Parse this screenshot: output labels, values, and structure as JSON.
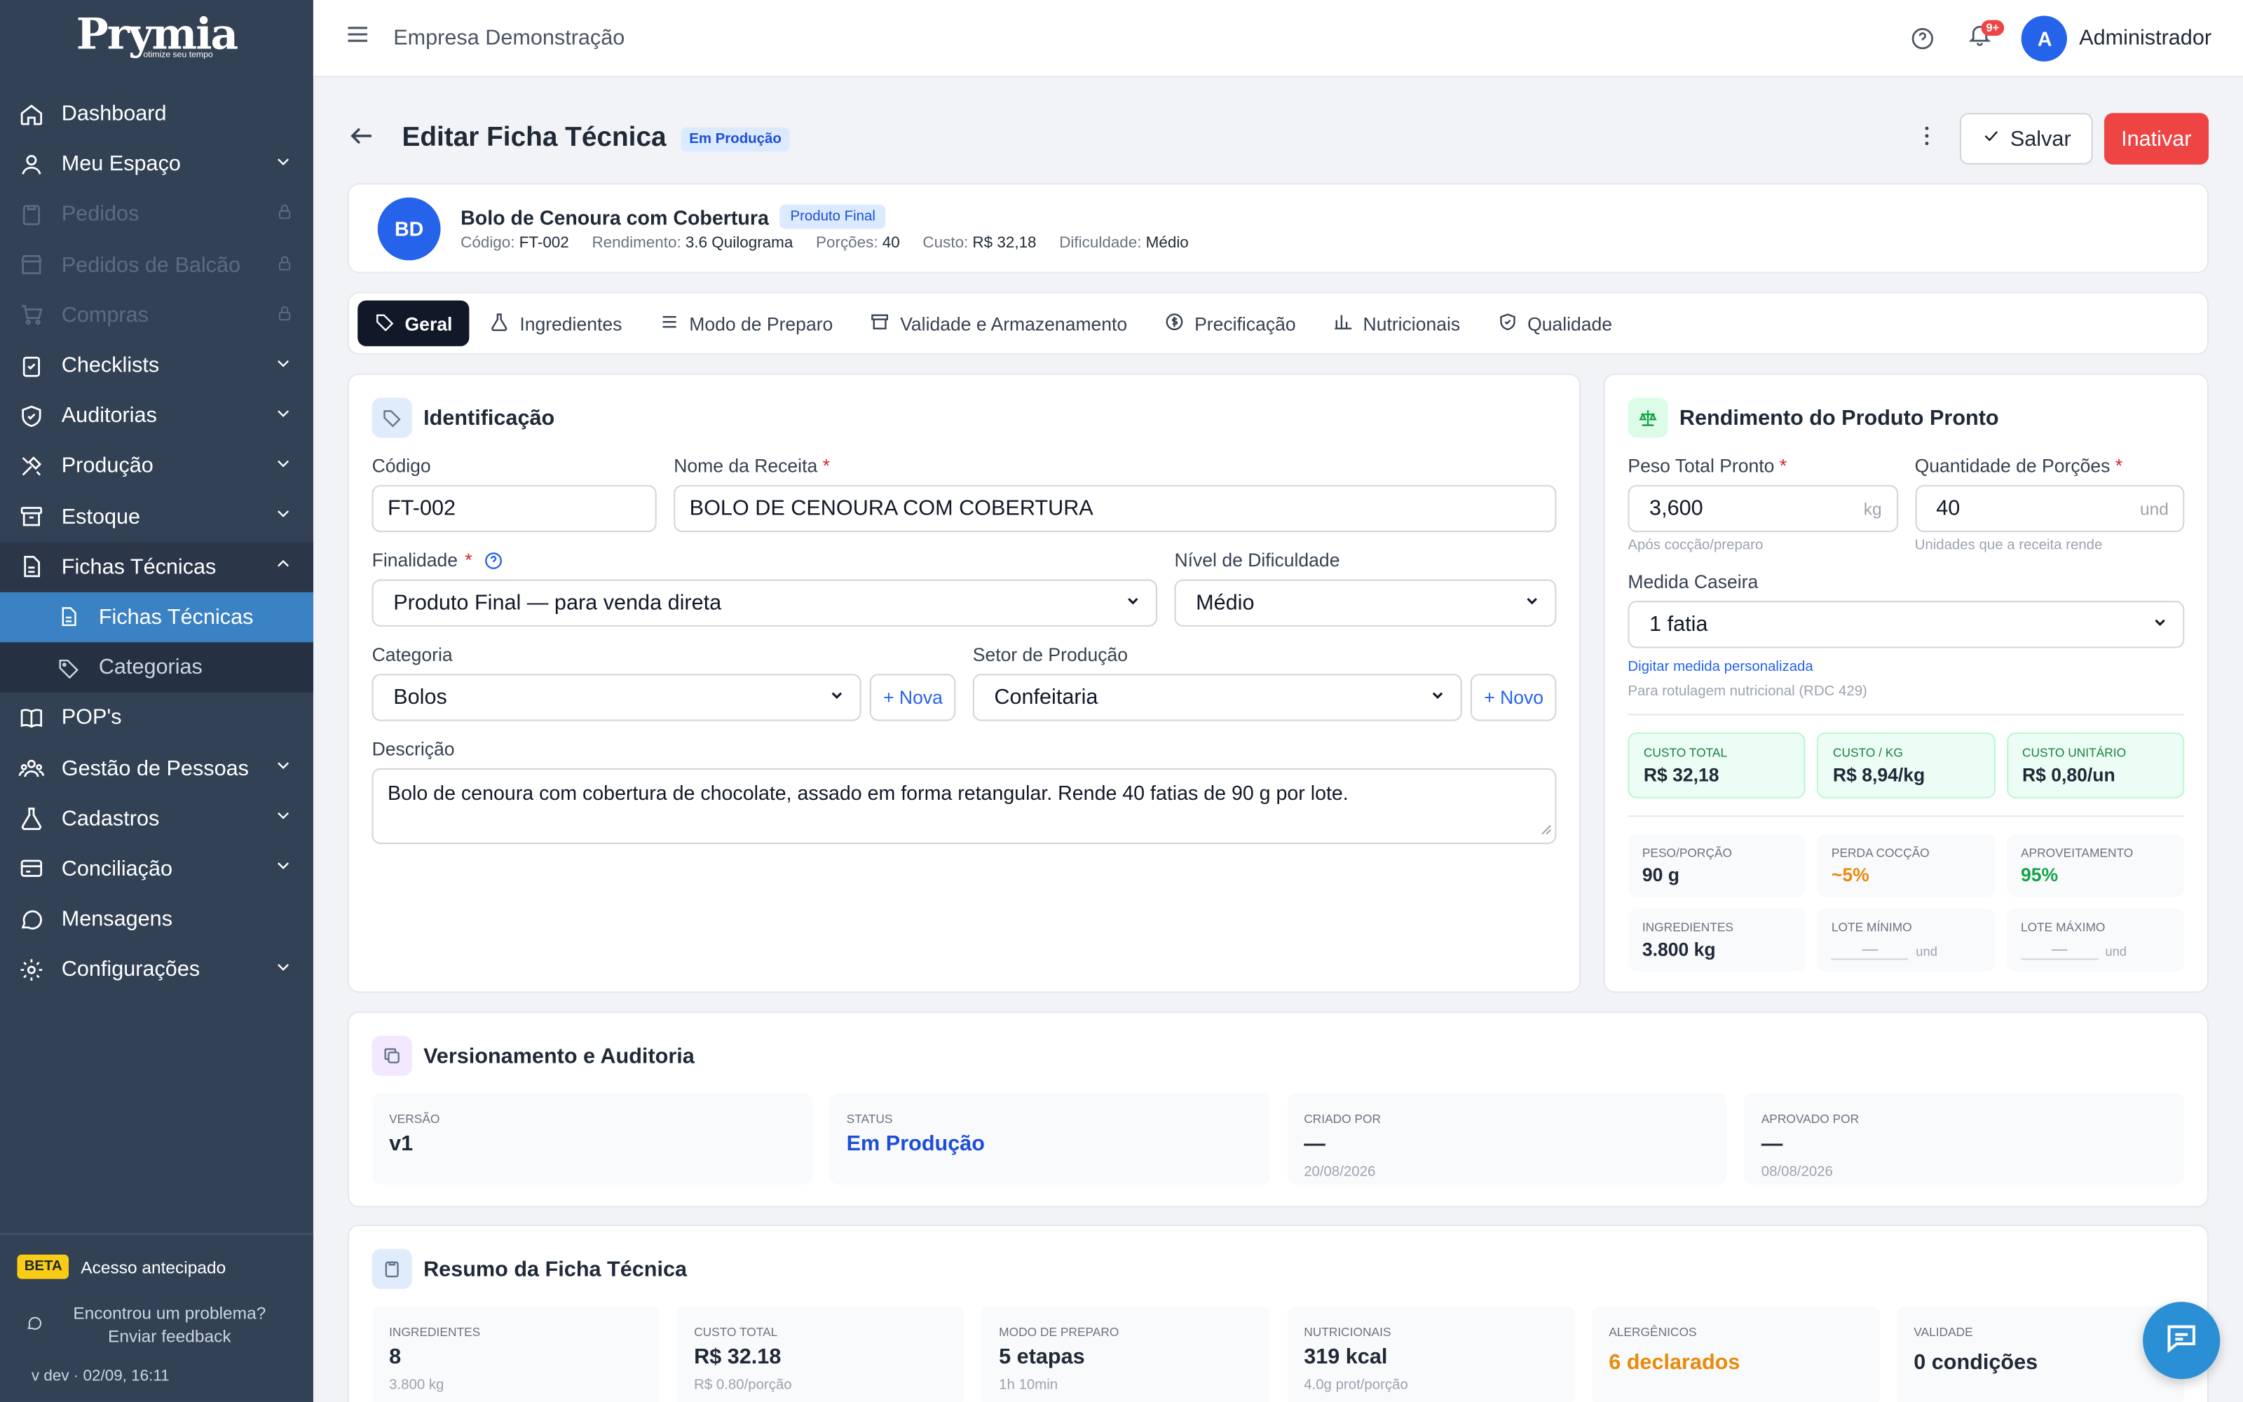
{
  "brand": {
    "logo": "Prymia",
    "tagline": "otimize seu tempo"
  },
  "sidebar": {
    "items": [
      {
        "label": "Dashboard",
        "icon": "home-icon"
      },
      {
        "label": "Meu Espaço",
        "icon": "user-icon"
      },
      {
        "label": "Pedidos",
        "icon": "clipboard-icon"
      },
      {
        "label": "Pedidos de Balcão",
        "icon": "store-icon"
      },
      {
        "label": "Compras",
        "icon": "cart-icon"
      },
      {
        "label": "Checklists",
        "icon": "checklist-icon"
      },
      {
        "label": "Auditorias",
        "icon": "shield-icon"
      },
      {
        "label": "Produção",
        "icon": "tools-icon"
      },
      {
        "label": "Estoque",
        "icon": "box-icon"
      },
      {
        "label": "Fichas Técnicas",
        "icon": "file-icon"
      },
      {
        "label": "Fichas Técnicas",
        "icon": "file-icon"
      },
      {
        "label": "Categorias",
        "icon": "tag-icon"
      },
      {
        "label": "POP's",
        "icon": "book-icon"
      },
      {
        "label": "Gestão de Pessoas",
        "icon": "people-icon"
      },
      {
        "label": "Cadastros",
        "icon": "flask-icon"
      },
      {
        "label": "Conciliação",
        "icon": "card-icon"
      },
      {
        "label": "Mensagens",
        "icon": "chat-icon"
      },
      {
        "label": "Configurações",
        "icon": "gear-icon"
      }
    ],
    "beta_badge": "BETA",
    "beta_text": "Acesso antecipado",
    "feedback_line1": "Encontrou um problema?",
    "feedback_line2": "Enviar feedback",
    "version": "v dev · 02/09, 16:11"
  },
  "topbar": {
    "company": "Empresa Demonstração",
    "notif_count": "9+",
    "avatar": "A",
    "user": "Administrador"
  },
  "page": {
    "title": "Editar Ficha Técnica",
    "status": "Em Produção",
    "save": "Salvar",
    "inactivate": "Inativar"
  },
  "product": {
    "initials": "BD",
    "name": "Bolo de Cenoura com Cobertura",
    "type": "Produto Final",
    "codigo_label": "Código:",
    "codigo": "FT-002",
    "rend_label": "Rendimento:",
    "rendimento": "3.6 Quilograma",
    "porcoes_label": "Porções:",
    "porcoes": "40",
    "custo_label": "Custo:",
    "custo": "R$ 32,18",
    "dif_label": "Dificuldade:",
    "dificuldade": "Médio"
  },
  "tabs": [
    "Geral",
    "Ingredientes",
    "Modo de Preparo",
    "Validade e Armazenamento",
    "Precificação",
    "Nutricionais",
    "Qualidade"
  ],
  "ident": {
    "title": "Identificação",
    "codigo_label": "Código",
    "codigo": "FT-002",
    "nome_label": "Nome da Receita",
    "nome": "BOLO DE CENOURA COM COBERTURA",
    "finalidade_label": "Finalidade",
    "finalidade": "Produto Final — para venda direta",
    "nivel_label": "Nível de Dificuldade",
    "nivel": "Médio",
    "categoria_label": "Categoria",
    "categoria": "Bolos",
    "nova": "+ Nova",
    "setor_label": "Setor de Produção",
    "setor": "Confeitaria",
    "novo": "+ Novo",
    "descricao_label": "Descrição",
    "descricao": "Bolo de cenoura com cobertura de chocolate, assado em forma retangular. Rende 40 fatias de 90 g por lote."
  },
  "rend": {
    "title": "Rendimento do Produto Pronto",
    "peso_label": "Peso Total Pronto",
    "peso": "3,600",
    "peso_unit": "kg",
    "peso_hint": "Após cocção/preparo",
    "qtd_label": "Quantidade de Porções",
    "qtd": "40",
    "qtd_unit": "und",
    "qtd_hint": "Unidades que a receita rende",
    "medida_label": "Medida Caseira",
    "medida": "1 fatia",
    "custom_link": "Digitar medida personalizada",
    "rdc": "Para rotulagem nutricional (RDC 429)",
    "costs": [
      {
        "k": "Custo Total",
        "v": "R$ 32,18"
      },
      {
        "k": "Custo / kg",
        "v": "R$ 8,94/kg"
      },
      {
        "k": "Custo Unitário",
        "v": "R$ 0,80/un"
      }
    ],
    "stats": [
      {
        "k": "Peso/Porção",
        "v": "90 g"
      },
      {
        "k": "Perda Cocção",
        "v": "~5%"
      },
      {
        "k": "Aproveitamento",
        "v": "95%"
      },
      {
        "k": "Ingredientes",
        "v": "3.800 kg"
      },
      {
        "k": "Lote Mínimo",
        "v": "—",
        "u": "und"
      },
      {
        "k": "Lote Máximo",
        "v": "—",
        "u": "und"
      }
    ],
    "colors": {
      "orange": "#ea8a0c",
      "green": "#16a34a"
    }
  },
  "versao": {
    "title": "Versionamento e Auditoria",
    "items": [
      {
        "k": "Versão",
        "v": "v1",
        "s": ""
      },
      {
        "k": "Status",
        "v": "Em Produção",
        "s": ""
      },
      {
        "k": "Criado por",
        "v": "—",
        "s": "20/08/2026"
      },
      {
        "k": "Aprovado por",
        "v": "—",
        "s": "08/08/2026"
      }
    ]
  },
  "resumo": {
    "title": "Resumo da Ficha Técnica",
    "items": [
      {
        "k": "Ingredientes",
        "v": "8",
        "s": "3.800 kg"
      },
      {
        "k": "Custo Total",
        "v": "R$ 32.18",
        "s": "R$ 0.80/porção"
      },
      {
        "k": "Modo de Preparo",
        "v": "5 etapas",
        "s": "1h 10min"
      },
      {
        "k": "Nutricionais",
        "v": "319 kcal",
        "s": "4.0g prot/porção"
      },
      {
        "k": "Alergênicos",
        "v": "6 declarados",
        "s": ""
      },
      {
        "k": "Validade",
        "v": "0 condições",
        "s": ""
      }
    ]
  }
}
